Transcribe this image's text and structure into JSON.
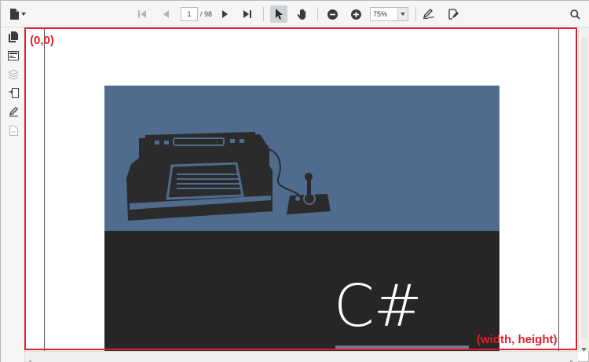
{
  "toolbar": {
    "file_icon": "document-icon",
    "page_current": "1",
    "page_total": "/ 98",
    "zoom": "75%",
    "buttons": [
      "first-page-icon",
      "previous-page-icon",
      "next-page-icon",
      "last-page-icon",
      "select-tool-icon",
      "pan-tool-icon",
      "zoom-out-icon",
      "zoom-in-icon",
      "signature-icon",
      "form-fill-icon",
      "search-icon"
    ]
  },
  "sidebar": {
    "items": [
      "thumbnails-icon",
      "bookmarks-icon",
      "layers-icon",
      "attachments-icon",
      "annotations-icon",
      "blank-page-icon"
    ]
  },
  "document": {
    "cover_title": "C#"
  },
  "annotations": {
    "origin": "(0,0)",
    "size": "(width, height)"
  },
  "colors": {
    "cover_top": "#4f6b8e",
    "cover_bottom": "#262626",
    "annotation": "#e0202a",
    "icon": "#3a3a3a"
  }
}
